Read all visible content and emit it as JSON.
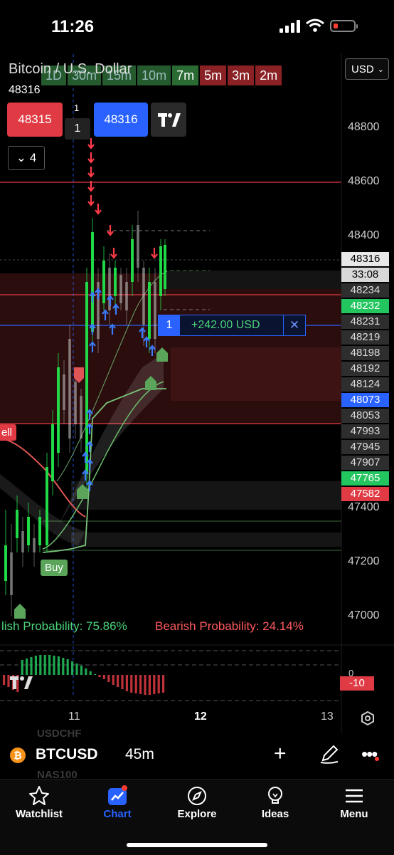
{
  "status_bar": {
    "time": "11:26"
  },
  "chart": {
    "symbol_title": "Bitcoin / U.S. Dollar",
    "last_price": "48316",
    "timeframes": [
      "1D",
      "30m",
      "15m",
      "10m",
      "7m",
      "5m",
      "3m",
      "2m"
    ],
    "currency": "USD",
    "sell_price": "48315",
    "buy_price": "48316",
    "quantity_small": "1",
    "quantity": "1",
    "collapse_count": "4",
    "price_axis": [
      "48800",
      "48600",
      "48400",
      "47400",
      "47200",
      "47000"
    ],
    "price_badges": [
      {
        "value": "48316",
        "style": "current"
      },
      {
        "value": "33:08",
        "style": "timer"
      },
      {
        "value": "48234",
        "style": "gray"
      },
      {
        "value": "48232",
        "style": "green"
      },
      {
        "value": "48231",
        "style": "gray"
      },
      {
        "value": "48219",
        "style": "gray"
      },
      {
        "value": "48198",
        "style": "gray"
      },
      {
        "value": "48192",
        "style": "gray"
      },
      {
        "value": "48124",
        "style": "gray"
      },
      {
        "value": "48073",
        "style": "blue"
      },
      {
        "value": "48053",
        "style": "gray"
      },
      {
        "value": "47993",
        "style": "gray"
      },
      {
        "value": "47945",
        "style": "gray"
      },
      {
        "value": "47907",
        "style": "gray"
      },
      {
        "value": "47765",
        "style": "green"
      },
      {
        "value": "47582",
        "style": "red"
      }
    ],
    "position": {
      "qty": "1",
      "pnl": "+242.00 USD"
    },
    "signals": {
      "buy": "Buy",
      "sell": "ell"
    },
    "bullish_prob": "lish Probability: 75.86%",
    "bearish_prob": "Bearish Probability: 24.14%",
    "indicator_zero": "0",
    "indicator_value": "-10",
    "x_axis": [
      "11",
      "12",
      "13"
    ],
    "colors": {
      "bull": "#22c55e",
      "bear": "#e03b44",
      "blue": "#2962ff",
      "accent": "#2962ff"
    }
  },
  "symbol_bar": {
    "ghost_top": "USDCHF",
    "ghost_bottom": "NAS100",
    "coin_glyph": "₿",
    "symbol": "BTCUSD",
    "interval": "45m",
    "plus_glyph": "+",
    "more_glyph": "•••"
  },
  "tabs": [
    {
      "label": "Watchlist",
      "icon": "star-icon"
    },
    {
      "label": "Chart",
      "icon": "chart-icon"
    },
    {
      "label": "Explore",
      "icon": "compass-icon"
    },
    {
      "label": "Ideas",
      "icon": "lightbulb-icon"
    },
    {
      "label": "Menu",
      "icon": "menu-icon"
    }
  ]
}
